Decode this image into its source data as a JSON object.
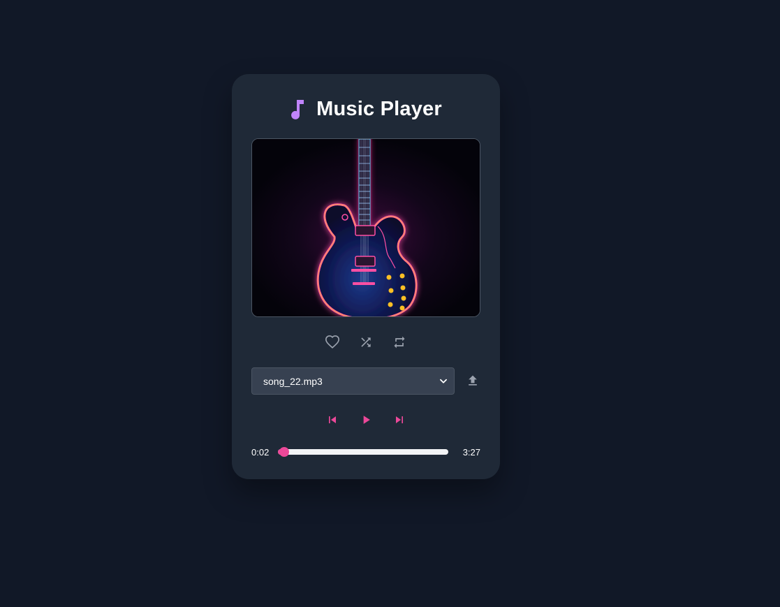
{
  "app": {
    "title": "Music Player",
    "icon": "music-note-icon"
  },
  "colors": {
    "background": "#111827",
    "card": "#1f2937",
    "accent": "#ec4899",
    "title_icon": "#c084fc",
    "muted_icon": "#9ca3af",
    "select_bg": "#374151"
  },
  "album_art": {
    "description_icon": "neon-guitar-artwork"
  },
  "actions": [
    {
      "name": "favorite",
      "icon": "heart-icon"
    },
    {
      "name": "shuffle",
      "icon": "shuffle-icon"
    },
    {
      "name": "repeat",
      "icon": "repeat-icon"
    }
  ],
  "track_select": {
    "selected": "song_22.mp3",
    "upload_icon": "upload-icon"
  },
  "transport": {
    "previous_icon": "skip-previous-icon",
    "play_icon": "play-icon",
    "next_icon": "skip-next-icon"
  },
  "progress": {
    "current": "0:02",
    "duration": "3:27",
    "fraction": 0.01
  }
}
